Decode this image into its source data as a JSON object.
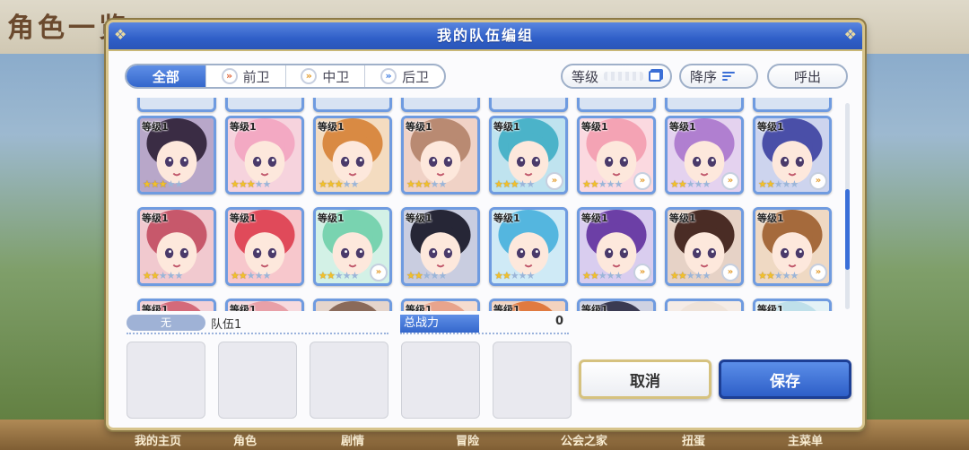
{
  "background": {
    "screen_title": "角色一览",
    "nav_items": [
      "我的主页",
      "角色",
      "剧情",
      "冒险",
      "公会之家",
      "扭蛋",
      "主菜单"
    ]
  },
  "dialog": {
    "title": "我的队伍编组",
    "filters": [
      {
        "label": "全部",
        "icon": null,
        "active": true
      },
      {
        "label": "前卫",
        "icon": "front-position-icon",
        "active": false
      },
      {
        "label": "中卫",
        "icon": "mid-position-icon",
        "active": false
      },
      {
        "label": "后卫",
        "icon": "back-position-icon",
        "active": false
      }
    ],
    "sort_field_label": "等级",
    "sort_order_label": "降序",
    "call_label": "呼出",
    "role_glyph": "»",
    "colors": {
      "accent": "#3467cc",
      "card_border": "#6f9be0",
      "star": "#f2c12b",
      "front_icon": "#e0663a",
      "mid_icon": "#e39b2c",
      "back_icon": "#3d7be0"
    }
  },
  "roster": {
    "rows": [
      [
        {
          "level": "等级1",
          "stars": 3,
          "role": "none",
          "hair": "#3a2c44",
          "bg": "#b8a7c9"
        },
        {
          "level": "等级1",
          "stars": 3,
          "role": "none",
          "hair": "#f3a9c3",
          "bg": "#f6d3dd"
        },
        {
          "level": "等级1",
          "stars": 3,
          "role": "none",
          "hair": "#d98a43",
          "bg": "#f4dcc0"
        },
        {
          "level": "等级1",
          "stars": 3,
          "role": "none",
          "hair": "#b98a72",
          "bg": "#f0d2c6"
        },
        {
          "level": "等级1",
          "stars": 3,
          "role": "mid",
          "hair": "#4bb3c9",
          "bg": "#bfe3ef"
        },
        {
          "level": "等级1",
          "stars": 2,
          "role": "mid",
          "hair": "#f4a3b4",
          "bg": "#fbd9e0"
        },
        {
          "level": "等级1",
          "stars": 2,
          "role": "mid",
          "hair": "#b07fd0",
          "bg": "#e4d2ef"
        },
        {
          "level": "等级1",
          "stars": 2,
          "role": "mid",
          "hair": "#4a4fa8",
          "bg": "#cdd4ee"
        }
      ],
      [
        {
          "level": "等级1",
          "stars": 2,
          "role": "none",
          "hair": "#c7586b",
          "bg": "#f1c9cf"
        },
        {
          "level": "等级1",
          "stars": 2,
          "role": "none",
          "hair": "#e04a5a",
          "bg": "#f7c7cc"
        },
        {
          "level": "等级1",
          "stars": 2,
          "role": "mid",
          "hair": "#79d3b0",
          "bg": "#d3f1e6"
        },
        {
          "level": "等级1",
          "stars": 2,
          "role": "none",
          "hair": "#262636",
          "bg": "#c9cde0"
        },
        {
          "level": "等级1",
          "stars": 2,
          "role": "none",
          "hair": "#54b6df",
          "bg": "#cfeaf6"
        },
        {
          "level": "等级1",
          "stars": 2,
          "role": "mid",
          "hair": "#6c3fa6",
          "bg": "#d9cdef"
        },
        {
          "level": "等级1",
          "stars": 2,
          "role": "mid",
          "hair": "#4a2c25",
          "bg": "#e6d2c6"
        },
        {
          "level": "等级1",
          "stars": 2,
          "role": "mid",
          "hair": "#a56a3c",
          "bg": "#efd9c3"
        }
      ],
      [
        {
          "level": "等级1",
          "stars": 0,
          "role": "none",
          "hair": "#d46a7a",
          "bg": "#f3d0d6"
        },
        {
          "level": "等级1",
          "stars": 0,
          "role": "none",
          "hair": "#e8a0a8",
          "bg": "#f7dade"
        },
        {
          "level": "",
          "stars": 0,
          "role": "none",
          "hair": "#8a6a5a",
          "bg": "#e5d5cc"
        },
        {
          "level": "等级1",
          "stars": 0,
          "role": "none",
          "hair": "#e8a48c",
          "bg": "#f5dccf"
        },
        {
          "level": "等级1",
          "stars": 0,
          "role": "none",
          "hair": "#e07a40",
          "bg": "#f3d3bf"
        },
        {
          "level": "等级1",
          "stars": 0,
          "role": "none",
          "hair": "#3a3a52",
          "bg": "#cfd2e2"
        },
        {
          "level": "",
          "stars": 0,
          "role": "none",
          "hair": "#efe3d9",
          "bg": "#f5ece6"
        },
        {
          "level": "等级1",
          "stars": 0,
          "role": "none",
          "hair": "#bfe0ea",
          "bg": "#e4f2f6"
        }
      ]
    ]
  },
  "team": {
    "tag": "无",
    "name": "队伍1",
    "power_label": "总战力",
    "power_value": "0",
    "slots": 5
  },
  "actions": {
    "cancel": "取消",
    "save": "保存"
  }
}
